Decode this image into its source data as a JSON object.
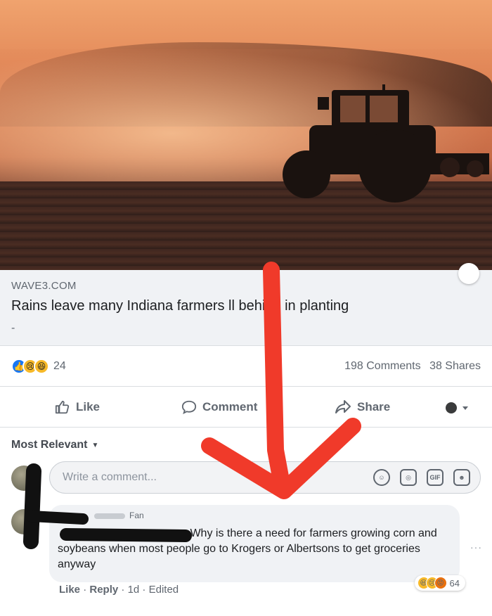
{
  "post": {
    "source": "WAVE3.COM",
    "headline": "Rains leave many Indiana farmers ll behind in planting",
    "dash": "-"
  },
  "stats": {
    "reaction_count": "24",
    "comments": "198 Comments",
    "shares": "38 Shares"
  },
  "actions": {
    "like": "Like",
    "comment": "Comment",
    "share": "Share"
  },
  "sort": {
    "label": "Most Relevant"
  },
  "compose": {
    "placeholder": "Write a comment...",
    "icons": [
      "emoji-icon",
      "camera-icon",
      "gif-icon",
      "sticker-icon"
    ]
  },
  "comment": {
    "badge": "Fan",
    "text": "Why is there a need for farmers growing corn and soybeans when most people go to Krogers or Albertsons to get groceries anyway",
    "reaction_count": "64",
    "like": "Like",
    "reply": "Reply",
    "time": "1d",
    "edited": "Edited",
    "separator": "·"
  },
  "colors": {
    "accent": "#1877f2",
    "arrow": "#f03a2a",
    "scribble": "#111111"
  }
}
